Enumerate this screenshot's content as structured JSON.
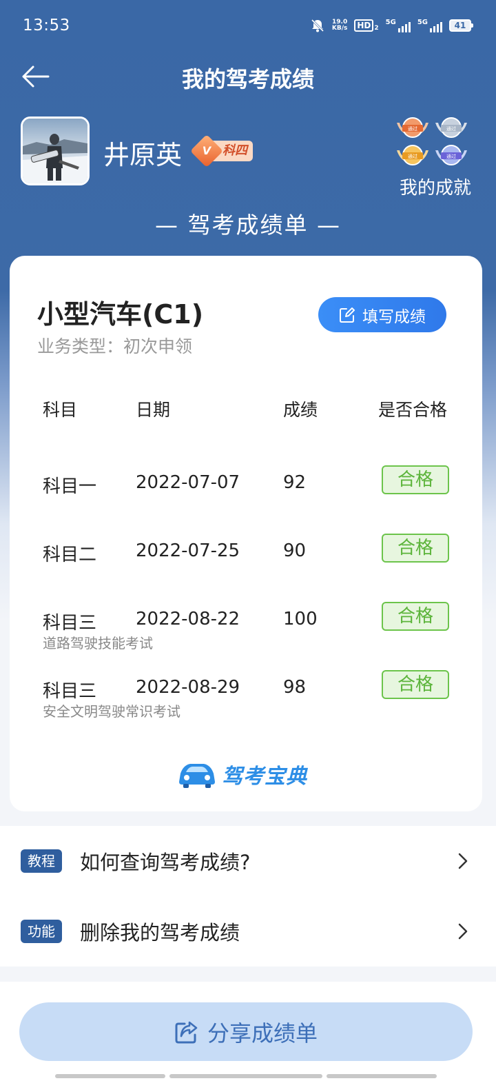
{
  "status_bar": {
    "time": "13:53",
    "net_speed_value": "19.0",
    "net_speed_unit": "KB/s",
    "hd_label": "HD",
    "hd_sub": "2",
    "sig1_label": "5G",
    "sig2_label": "5G",
    "battery": "41"
  },
  "header": {
    "title": "我的驾考成绩"
  },
  "profile": {
    "name": "井原英",
    "level_badge": "科四",
    "level_badge_icon": "V",
    "achievements_label": "我的成就",
    "medal_text": "通过"
  },
  "sheet_title": "— 驾考成绩单 —",
  "card": {
    "vehicle": "小型汽车(C1)",
    "business_type": "业务类型：初次申领",
    "fill_button": "填写成绩",
    "headers": {
      "subject": "科目",
      "date": "日期",
      "score": "成绩",
      "pass": "是否合格"
    },
    "rows": [
      {
        "subject": "科目一",
        "date": "2022-07-07",
        "score": "92",
        "pass": "合格",
        "note": ""
      },
      {
        "subject": "科目二",
        "date": "2022-07-25",
        "score": "90",
        "pass": "合格",
        "note": ""
      },
      {
        "subject": "科目三",
        "date": "2022-08-22",
        "score": "100",
        "pass": "合格",
        "note": "道路驾驶技能考试"
      },
      {
        "subject": "科目三",
        "date": "2022-08-29",
        "score": "98",
        "pass": "合格",
        "note": "安全文明驾驶常识考试"
      }
    ],
    "brand": "驾考宝典"
  },
  "links": [
    {
      "tag": "教程",
      "text": "如何查询驾考成绩?"
    },
    {
      "tag": "功能",
      "text": "删除我的驾考成绩"
    }
  ],
  "share_button": "分享成绩单",
  "colors": {
    "header_bg": "#3a68a6",
    "accent_blue": "#2f79ea",
    "pass_green": "#5bb43a",
    "tag_blue": "#2f5e9e"
  }
}
